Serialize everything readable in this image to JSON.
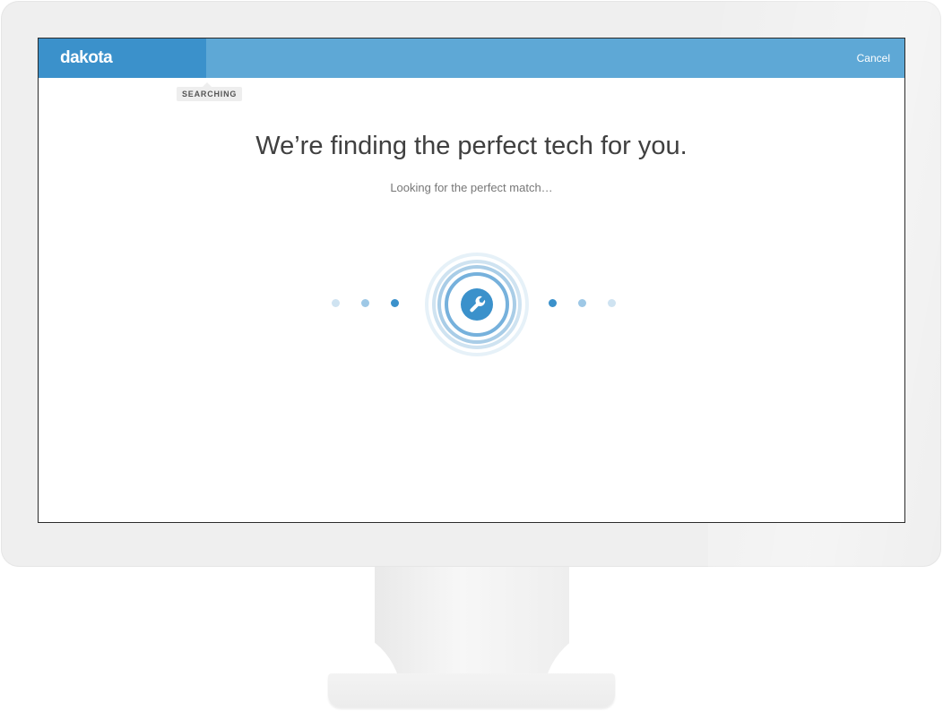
{
  "app": {
    "brand": "dakota",
    "cancel_label": "Cancel"
  },
  "progress": {
    "step_label": "SEARCHING"
  },
  "main": {
    "headline": "We’re finding the perfect tech for you.",
    "subtext": "Looking for the perfect match…"
  },
  "graphic": {
    "center_icon": "wrench-icon",
    "colors": {
      "primary": "#3b91cb",
      "header": "#5ea8d6",
      "dot_light": "#cfe3f1",
      "dot_mid": "#9ec8e6",
      "dot_dark": "#3b91cb"
    }
  }
}
